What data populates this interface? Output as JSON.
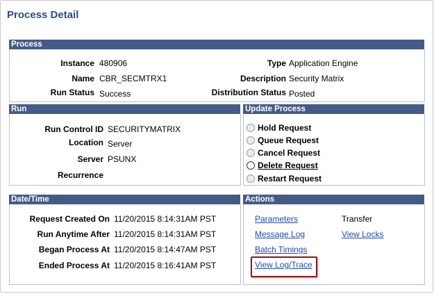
{
  "page": {
    "title": "Process Detail"
  },
  "process": {
    "header": "Process",
    "instance_label": "Instance",
    "instance_value": "480906",
    "type_label": "Type",
    "type_value": "Application Engine",
    "name_label": "Name",
    "name_value": "CBR_SECMTRX1",
    "description_label": "Description",
    "description_value": "Security Matrix",
    "run_status_label": "Run Status",
    "run_status_value": "Success",
    "distribution_status_label": "Distribution Status",
    "distribution_status_value": "Posted"
  },
  "run": {
    "header": "Run",
    "run_control_id_label": "Run Control ID",
    "run_control_id_value": "SECURITYMATRIX",
    "location_label": "Location",
    "location_value": "Server",
    "server_label": "Server",
    "server_value": "PSUNX",
    "recurrence_label": "Recurrence",
    "recurrence_value": ""
  },
  "update_process": {
    "header": "Update Process",
    "options": [
      {
        "label": "Hold Request",
        "enabled": false
      },
      {
        "label": "Queue Request",
        "enabled": false
      },
      {
        "label": "Cancel Request",
        "enabled": false
      },
      {
        "label": "Delete Request",
        "enabled": true
      },
      {
        "label": "Restart Request",
        "enabled": false
      }
    ]
  },
  "datetime": {
    "header": "Date/Time",
    "rows": [
      {
        "label": "Request Created On",
        "value": "11/20/2015  8:14:31AM PST"
      },
      {
        "label": "Run Anytime After",
        "value": "11/20/2015  8:14:31AM PST"
      },
      {
        "label": "Began Process At",
        "value": "11/20/2015  8:14:47AM PST"
      },
      {
        "label": "Ended Process At",
        "value": "11/20/2015  8:16:41AM PST"
      }
    ]
  },
  "actions": {
    "header": "Actions",
    "parameters": "Parameters",
    "transfer": "Transfer",
    "message_log": "Message Log",
    "view_locks": "View Locks",
    "batch_timings": "Batch Timings",
    "view_log_trace": "View Log/Trace"
  },
  "colors": {
    "header_bg": "#455b87",
    "title": "#2b4a8c",
    "link": "#1f4bb0",
    "highlight_border": "#8b1a1a"
  }
}
